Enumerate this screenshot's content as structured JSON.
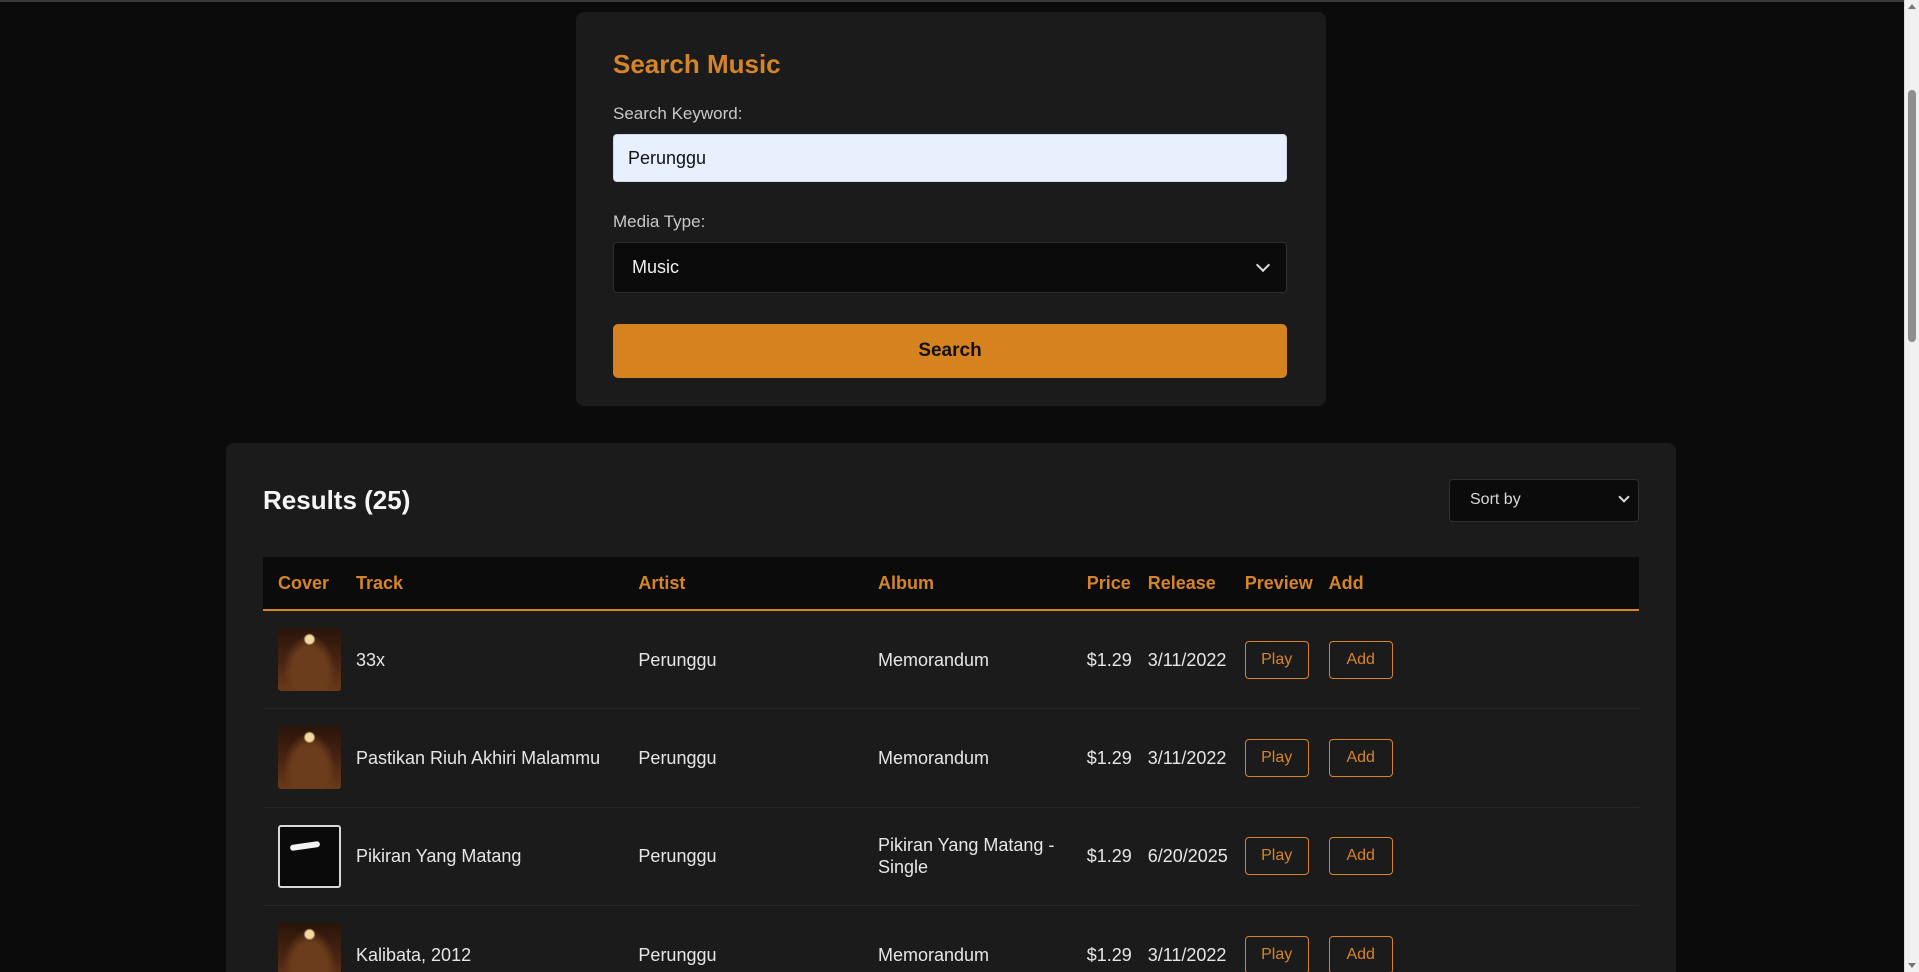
{
  "search": {
    "title": "Search Music",
    "keyword_label": "Search Keyword:",
    "keyword_value": "Perunggu",
    "media_label": "Media Type:",
    "media_value": "Music",
    "button_label": "Search"
  },
  "results": {
    "title": "Results (25)",
    "sort_value": "Sort by",
    "columns": [
      "Cover",
      "Track",
      "Artist",
      "Album",
      "Price",
      "Release",
      "Preview",
      "Add"
    ],
    "rows": [
      {
        "cover": "album-art-memorandum",
        "track": "33x",
        "artist": "Perunggu",
        "album": "Memorandum",
        "price": "$1.29",
        "release": "3/11/2022",
        "play": "Play",
        "add": "Add"
      },
      {
        "cover": "album-art-memorandum",
        "track": "Pastikan Riuh Akhiri Malammu",
        "artist": "Perunggu",
        "album": "Memorandum",
        "price": "$1.29",
        "release": "3/11/2022",
        "play": "Play",
        "add": "Add"
      },
      {
        "cover": "album-art-single",
        "track": "Pikiran Yang Matang",
        "artist": "Perunggu",
        "album": "Pikiran Yang Matang - Single",
        "price": "$1.29",
        "release": "6/20/2025",
        "play": "Play",
        "add": "Add"
      },
      {
        "cover": "album-art-memorandum",
        "track": "Kalibata, 2012",
        "artist": "Perunggu",
        "album": "Memorandum",
        "price": "$1.29",
        "release": "3/11/2022",
        "play": "Play",
        "add": "Add"
      }
    ]
  },
  "colors": {
    "accent": "#d6842a",
    "background": "#0b0b0b",
    "card": "#1b1b1b"
  }
}
